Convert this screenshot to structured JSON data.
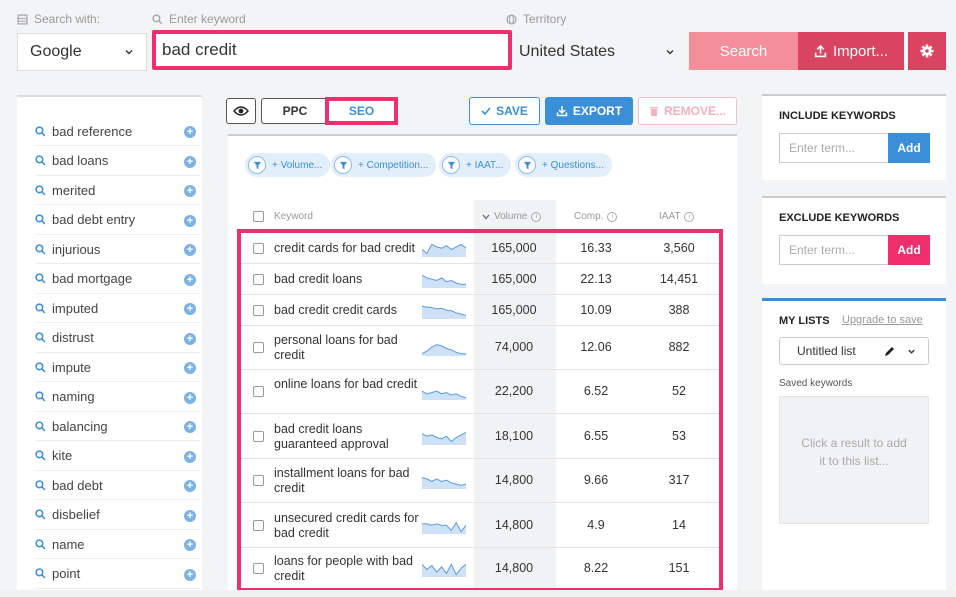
{
  "search_bar": {
    "search_with_label": "Search with:",
    "keyword_label": "Enter keyword",
    "territory_label": "Territory",
    "engine_value": "Google",
    "keyword_value": "bad credit",
    "territory_value": "United States",
    "search_button": "Search",
    "import_button": "Import...",
    "colors": {
      "search": "#f28f9b",
      "import": "#d94560",
      "highlight": "#ee2f6b"
    }
  },
  "sidebar": {
    "items": [
      "bad reference",
      "bad loans",
      "merited",
      "bad debt entry",
      "injurious",
      "bad mortgage",
      "imputed",
      "distrust",
      "impute",
      "naming",
      "balancing",
      "kite",
      "bad debt",
      "disbelief",
      "name",
      "point"
    ]
  },
  "toolbar": {
    "ppc_label": "PPC",
    "seo_label": "SEO",
    "save_label": "SAVE",
    "export_label": "EXPORT",
    "remove_label": "REMOVE..."
  },
  "filters": [
    "+ Volume...",
    "+ Competition...",
    "+ IAAT...",
    "+ Questions..."
  ],
  "table": {
    "headers": {
      "keyword": "Keyword",
      "volume": "Volume",
      "comp": "Comp.",
      "iaat": "IAAT"
    },
    "rows": [
      {
        "keyword": "credit cards for bad credit",
        "volume": "165,000",
        "comp": "16.33",
        "iaat": "3,560",
        "trend": [
          0.5,
          0.2,
          0.9,
          0.7,
          0.6,
          0.8,
          0.5,
          0.7,
          0.9,
          0.6
        ]
      },
      {
        "keyword": "bad credit loans",
        "volume": "165,000",
        "comp": "22.13",
        "iaat": "14,451",
        "trend": [
          0.9,
          0.7,
          0.6,
          0.5,
          0.7,
          0.4,
          0.5,
          0.3,
          0.2,
          0.2
        ]
      },
      {
        "keyword": "bad credit credit cards",
        "volume": "165,000",
        "comp": "10.09",
        "iaat": "388",
        "trend": [
          0.9,
          0.85,
          0.8,
          0.7,
          0.75,
          0.6,
          0.55,
          0.4,
          0.3,
          0.2
        ]
      },
      {
        "keyword": "personal loans for bad credit",
        "volume": "74,000",
        "comp": "12.06",
        "iaat": "882",
        "trend": [
          0.1,
          0.3,
          0.6,
          0.8,
          0.7,
          0.5,
          0.4,
          0.2,
          0.1,
          0.1
        ]
      },
      {
        "keyword": "online loans for bad credit",
        "volume": "22,200",
        "comp": "6.52",
        "iaat": "52",
        "trend": [
          0.6,
          0.4,
          0.5,
          0.6,
          0.4,
          0.5,
          0.3,
          0.4,
          0.2,
          0.1
        ]
      },
      {
        "keyword": "bad credit loans guaranteed approval",
        "volume": "18,100",
        "comp": "6.55",
        "iaat": "53",
        "trend": [
          0.8,
          0.6,
          0.7,
          0.5,
          0.4,
          0.6,
          0.2,
          0.5,
          0.7,
          0.9
        ]
      },
      {
        "keyword": "installment loans for bad credit",
        "volume": "14,800",
        "comp": "9.66",
        "iaat": "317",
        "trend": [
          0.8,
          0.7,
          0.5,
          0.7,
          0.5,
          0.6,
          0.4,
          0.3,
          0.2,
          0.3
        ]
      },
      {
        "keyword": "unsecured credit cards for bad credit",
        "volume": "14,800",
        "comp": "4.9",
        "iaat": "14",
        "trend": [
          0.7,
          0.7,
          0.6,
          0.7,
          0.6,
          0.6,
          0.2,
          0.8,
          0.1,
          0.6
        ]
      },
      {
        "keyword": "loans for people with bad credit",
        "volume": "14,800",
        "comp": "8.22",
        "iaat": "151",
        "trend": [
          0.9,
          0.5,
          0.8,
          0.3,
          0.7,
          0.2,
          0.9,
          0.1,
          0.6,
          0.9
        ]
      }
    ]
  },
  "right_panel": {
    "include_title": "INCLUDE KEYWORDS",
    "exclude_title": "EXCLUDE KEYWORDS",
    "term_placeholder": "Enter term...",
    "add_label": "Add",
    "my_lists_title": "MY LISTS",
    "upgrade_link": "Upgrade to save",
    "list_name": "Untitled list",
    "saved_keywords_label": "Saved keywords",
    "empty_hint_line1": "Click a result to add",
    "empty_hint_line2": "it to this list...",
    "colors": {
      "include_add": "#3b8fd9",
      "exclude_add": "#ee2f6b"
    }
  }
}
